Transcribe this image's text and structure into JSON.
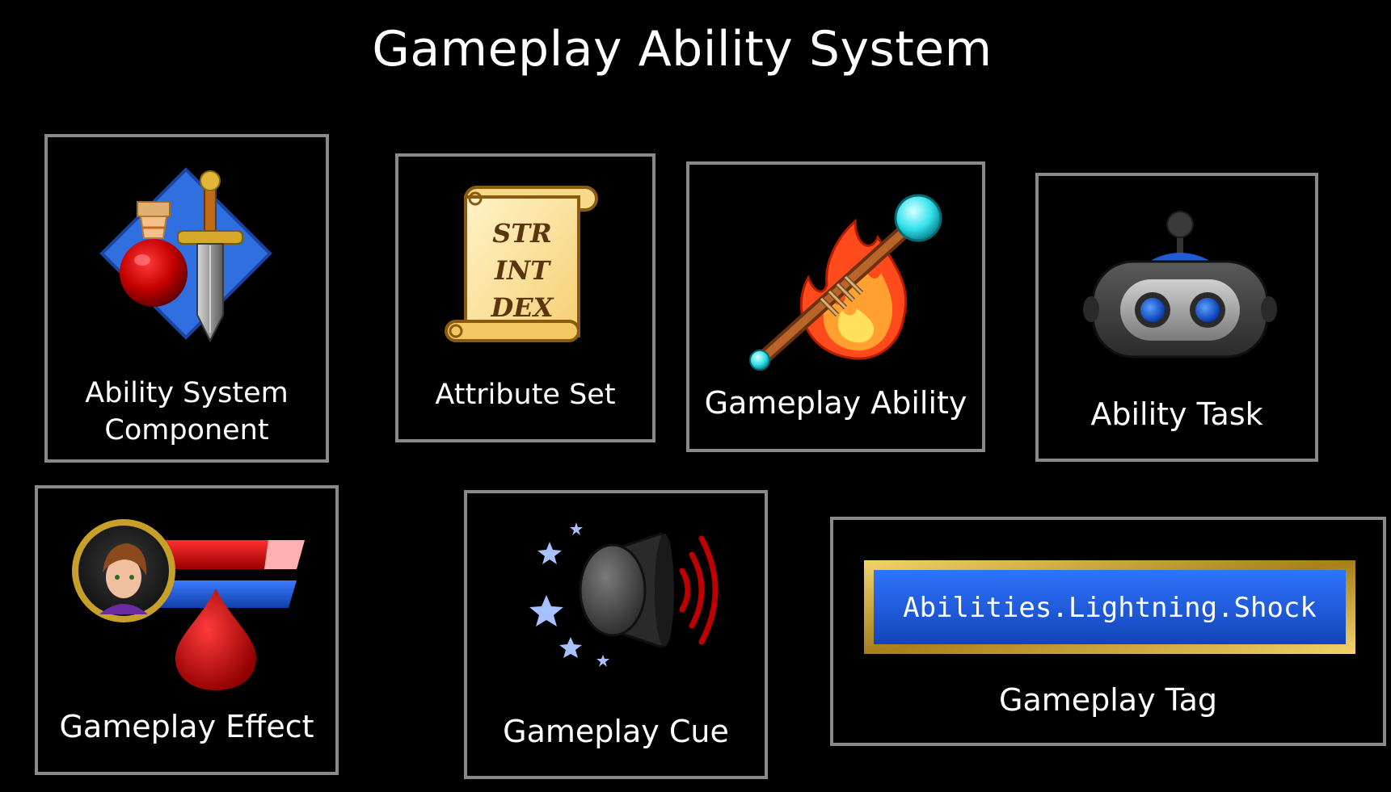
{
  "title": "Gameplay Ability System",
  "colors": {
    "background": "#000000",
    "card_border": "#8a8a8a",
    "text": "#ffffff",
    "tag_blue": "#1e5bd6",
    "tag_gold": "#c9a227",
    "blood_red": "#d40000",
    "cyan": "#35e3ec"
  },
  "cards": [
    {
      "id": "ability-system-component",
      "label_line1": "Ability System",
      "label_line2": "Component",
      "icon": "potion-sword-icon"
    },
    {
      "id": "attribute-set",
      "label": "Attribute Set",
      "icon": "scroll-icon",
      "scroll_lines": [
        "STR",
        "INT",
        "DEX"
      ]
    },
    {
      "id": "gameplay-ability",
      "label": "Gameplay Ability",
      "icon": "fire-staff-icon"
    },
    {
      "id": "ability-task",
      "label": "Ability Task",
      "icon": "robot-icon"
    },
    {
      "id": "gameplay-effect",
      "label": "Gameplay Effect",
      "icon": "health-bars-icon"
    },
    {
      "id": "gameplay-cue",
      "label": "Gameplay Cue",
      "icon": "speaker-stars-icon"
    },
    {
      "id": "gameplay-tag",
      "label": "Gameplay Tag",
      "icon": "tag-bar-icon",
      "tag_text": "Abilities.Lightning.Shock"
    }
  ]
}
